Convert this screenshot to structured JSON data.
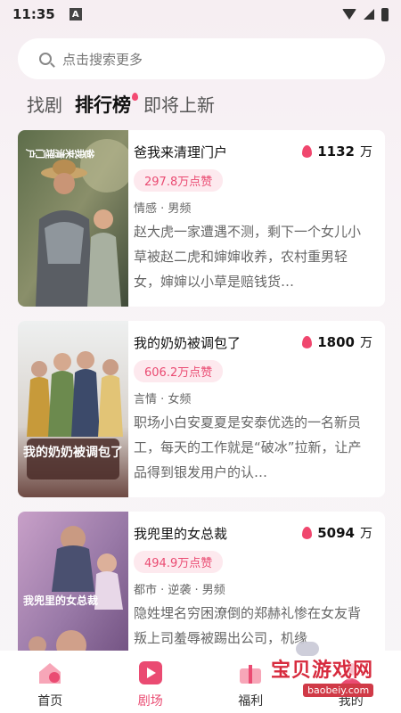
{
  "status_bar": {
    "time": "11:35",
    "app_badge": "A"
  },
  "search": {
    "placeholder": "点击搜索更多"
  },
  "tabs": [
    {
      "label": "找剧",
      "active": false
    },
    {
      "label": "排行榜",
      "active": true
    },
    {
      "label": "即将上新",
      "active": false
    }
  ],
  "cards": [
    {
      "title": "爸我来清理门户",
      "heat": "1132",
      "heat_unit": "万",
      "likes": "297.8万点赞",
      "tags": "情感 · 男频",
      "description": "赵大虎一家遭遇不测，剩下一个女儿小草被赵二虎和婶婶收养，农村重男轻女，婶婶以小草是赔钱货…",
      "cover_title": "爸我来清理门户"
    },
    {
      "title": "我的奶奶被调包了",
      "heat": "1800",
      "heat_unit": "万",
      "likes": "606.2万点赞",
      "tags": "言情 · 女频",
      "description": "职场小白安夏夏是安泰优选的一名新员工，每天的工作就是“破冰”拉新，让产品得到银发用户的认…",
      "cover_title": "我的奶奶被调包了"
    },
    {
      "title": "我兜里的女总裁",
      "heat": "5094",
      "heat_unit": "万",
      "likes": "494.9万点赞",
      "tags": "都市 · 逆袭 · 男频",
      "description": "隐姓埋名穷困潦倒的郑赫礼惨在女友背叛上司羞辱被踢出公司，机缘",
      "cover_title": "我兜里的女总裁"
    }
  ],
  "bottom_nav": [
    {
      "label": "首页",
      "active": false,
      "icon": "home-icon"
    },
    {
      "label": "剧场",
      "active": true,
      "icon": "theater-icon"
    },
    {
      "label": "福利",
      "active": false,
      "icon": "gift-icon"
    },
    {
      "label": "我的",
      "active": false,
      "icon": "profile-icon"
    }
  ],
  "watermark": {
    "text": "宝贝游戏网",
    "url": "baobeiy.com"
  },
  "colors": {
    "accent": "#ea4b72",
    "likes_bg": "#fde9ee",
    "flame": "#f0476e"
  }
}
